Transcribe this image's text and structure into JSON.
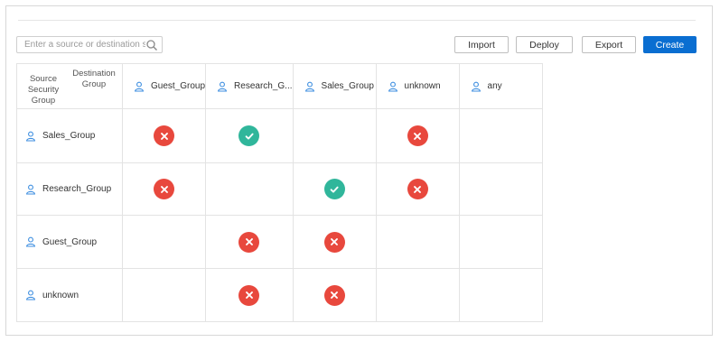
{
  "toolbar": {
    "search_placeholder": "Enter a source or destination sQ",
    "import_label": "Import",
    "deploy_label": "Deploy",
    "export_label": "Export",
    "create_label": "Create"
  },
  "colors": {
    "primary": "#0a6ed1",
    "deny": "#e8483d",
    "allow": "#30b69b",
    "group_icon": "#3d8ee0"
  },
  "matrix": {
    "corner_destination": "Destination Group",
    "corner_source": "Source Security Group",
    "columns": [
      "Guest_Group",
      "Research_G...",
      "Sales_Group",
      "unknown",
      "any"
    ],
    "rows": [
      {
        "label": "Sales_Group",
        "cells": [
          "deny",
          "allow",
          "",
          "deny",
          ""
        ]
      },
      {
        "label": "Research_Group",
        "cells": [
          "deny",
          "",
          "allow",
          "deny",
          ""
        ]
      },
      {
        "label": "Guest_Group",
        "cells": [
          "",
          "deny",
          "deny",
          "",
          ""
        ]
      },
      {
        "label": "unknown",
        "cells": [
          "",
          "deny",
          "deny",
          "",
          ""
        ]
      }
    ]
  }
}
